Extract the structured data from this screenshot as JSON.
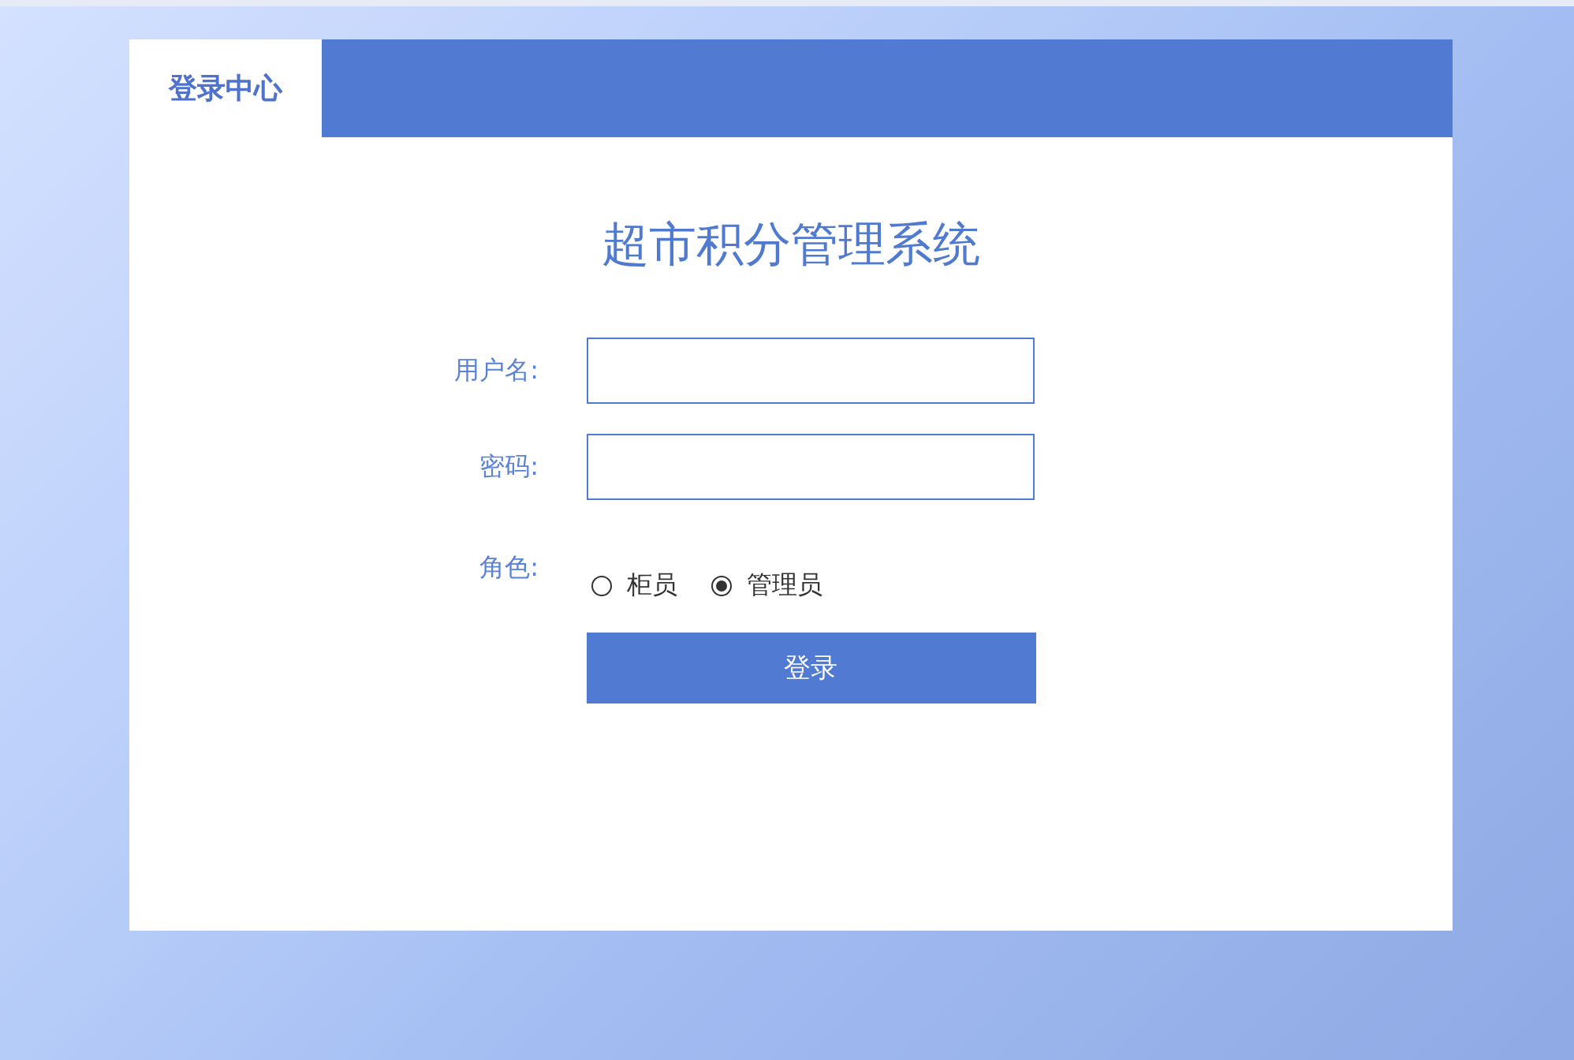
{
  "tabs": [
    {
      "label": "登录中心",
      "selected": true
    }
  ],
  "title": "超市积分管理系统",
  "fields": [
    {
      "label": "用户名:"
    },
    {
      "label": "密码:"
    }
  ],
  "role": {
    "label": "角色:",
    "options": [
      {
        "label": "柜员",
        "selected": false
      },
      {
        "label": "管理员",
        "selected": true
      }
    ]
  },
  "button": "登录"
}
